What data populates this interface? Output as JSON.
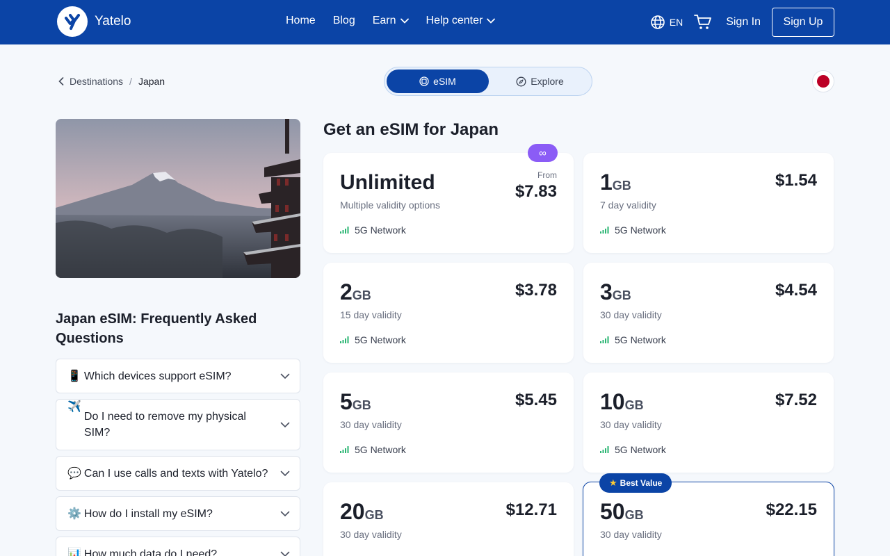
{
  "header": {
    "brand": "Yatelo",
    "nav": [
      {
        "label": "Home",
        "dropdown": false
      },
      {
        "label": "Blog",
        "dropdown": false
      },
      {
        "label": "Earn",
        "dropdown": true
      },
      {
        "label": "Help center",
        "dropdown": true
      }
    ],
    "language": "EN",
    "sign_in": "Sign In",
    "sign_up": "Sign Up",
    "icons": {
      "language": "globe-icon",
      "cart": "cart-icon"
    }
  },
  "breadcrumb": {
    "parent": "Destinations",
    "separator": "/",
    "current": "Japan"
  },
  "toggle": {
    "esim": "eSIM",
    "explore": "Explore",
    "active": "eSIM"
  },
  "faq": {
    "title": "Japan eSIM: Frequently Asked Questions",
    "items": [
      {
        "emoji": "📱",
        "question": "Which devices support eSIM?"
      },
      {
        "emoji": "✈️",
        "question": "Do I need to remove my physical SIM?"
      },
      {
        "emoji": "💬",
        "question": "Can I use calls and texts with Yatelo?"
      },
      {
        "emoji": "⚙️",
        "question": "How do I install my eSIM?"
      },
      {
        "emoji": "📊",
        "question": "How much data do I need?"
      }
    ]
  },
  "plans": {
    "title": "Get an eSIM for Japan",
    "network_label": "5G Network",
    "unlimited": {
      "badge": "∞",
      "name": "Unlimited",
      "validity": "Multiple validity options",
      "price_prefix": "From",
      "price": "$7.83"
    },
    "items": [
      {
        "amount": "1",
        "unit": "GB",
        "validity": "7 day validity",
        "price": "$1.54"
      },
      {
        "amount": "2",
        "unit": "GB",
        "validity": "15 day validity",
        "price": "$3.78"
      },
      {
        "amount": "3",
        "unit": "GB",
        "validity": "30 day validity",
        "price": "$4.54"
      },
      {
        "amount": "5",
        "unit": "GB",
        "validity": "30 day validity",
        "price": "$5.45"
      },
      {
        "amount": "10",
        "unit": "GB",
        "validity": "30 day validity",
        "price": "$7.52"
      },
      {
        "amount": "20",
        "unit": "GB",
        "validity": "30 day validity",
        "price": "$12.71"
      },
      {
        "amount": "50",
        "unit": "GB",
        "validity": "30 day validity",
        "price": "$22.15",
        "badge": "Best Value"
      }
    ]
  },
  "colors": {
    "primary": "#0b44a6",
    "accent_purple": "#8b5cf6",
    "network_green": "#2bb673",
    "flag_red": "#bc0025"
  }
}
